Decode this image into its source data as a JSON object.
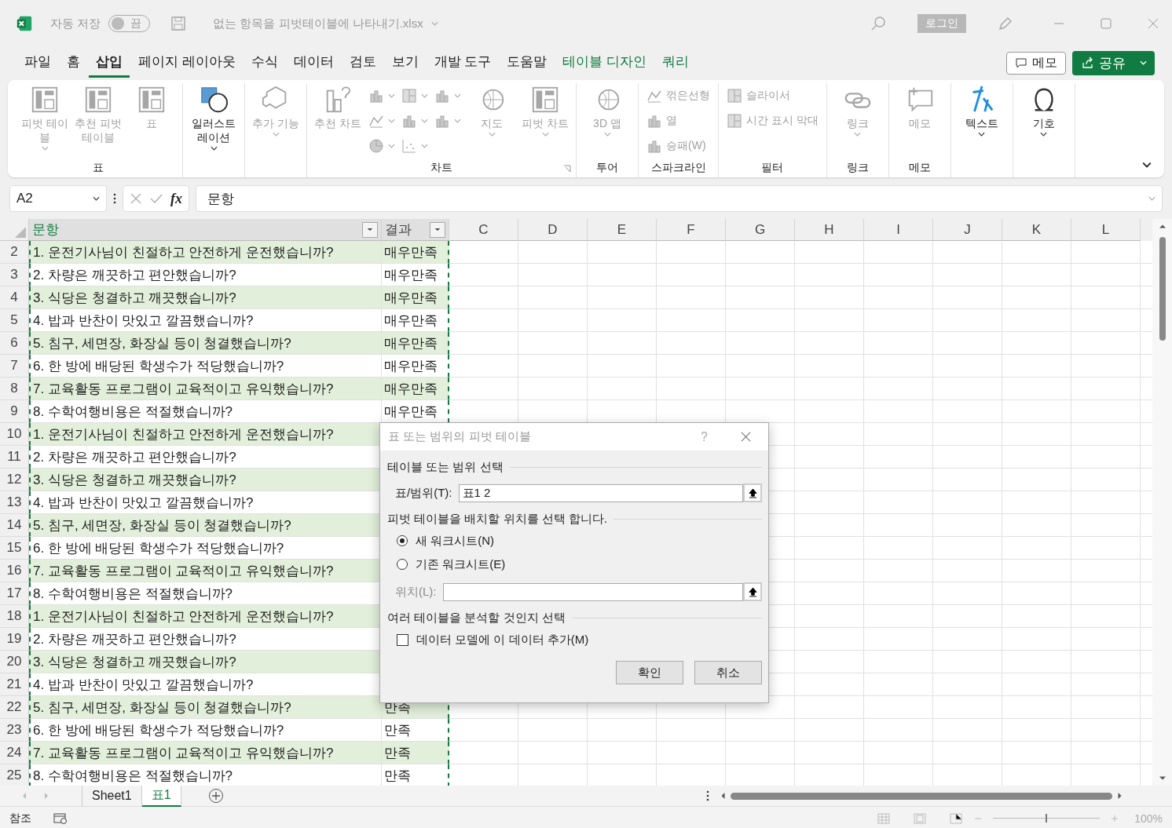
{
  "title_bar": {
    "autosave_label": "자동 저장",
    "autosave": {
      "label": "끔",
      "on": false
    },
    "filename": "없는 항목을 피벗테이블에 나타내기.xlsx",
    "login": "로그인"
  },
  "menu_tabs": [
    {
      "label": "파일",
      "selected": false,
      "kind": "normal"
    },
    {
      "label": "홈",
      "selected": false,
      "kind": "normal"
    },
    {
      "label": "삽입",
      "selected": true,
      "kind": "normal"
    },
    {
      "label": "페이지 레이아웃",
      "selected": false,
      "kind": "normal"
    },
    {
      "label": "수식",
      "selected": false,
      "kind": "normal"
    },
    {
      "label": "데이터",
      "selected": false,
      "kind": "normal"
    },
    {
      "label": "검토",
      "selected": false,
      "kind": "normal"
    },
    {
      "label": "보기",
      "selected": false,
      "kind": "normal"
    },
    {
      "label": "개발 도구",
      "selected": false,
      "kind": "normal"
    },
    {
      "label": "도움말",
      "selected": false,
      "kind": "normal"
    },
    {
      "label": "테이블 디자인",
      "selected": false,
      "kind": "contextual"
    },
    {
      "label": "쿼리",
      "selected": false,
      "kind": "contextual"
    }
  ],
  "comment_button": "메모",
  "share_button": "공유",
  "ribbon": [
    {
      "label": "표",
      "items": [
        {
          "kind": "large",
          "label": "피벗 테이블",
          "disabled": true,
          "dropdown": true
        },
        {
          "kind": "large",
          "label": "추천 피벗 테이블",
          "disabled": true,
          "dropdown": false
        },
        {
          "kind": "large",
          "label": "표",
          "disabled": true,
          "dropdown": false
        }
      ]
    },
    {
      "items": [
        {
          "kind": "large",
          "label": "일러스트레이션",
          "disabled": false,
          "dropdown": true
        }
      ]
    },
    {
      "items": [
        {
          "kind": "large",
          "label": "추가 기능",
          "disabled": true,
          "dropdown": true
        }
      ]
    },
    {
      "label": "차트",
      "launcher": true,
      "items": [
        {
          "kind": "large",
          "label": "추천 차트",
          "disabled": true,
          "dropdown": false
        },
        {
          "kind": "icon",
          "disabled": true,
          "dropdown": true
        },
        {
          "kind": "icon",
          "disabled": true,
          "dropdown": true
        },
        {
          "kind": "icon",
          "disabled": true,
          "dropdown": true
        },
        {
          "kind": "icon",
          "disabled": true,
          "dropdown": true
        },
        {
          "kind": "icon",
          "disabled": true,
          "dropdown": true
        },
        {
          "kind": "icon",
          "disabled": true,
          "dropdown": true
        },
        {
          "kind": "icon",
          "disabled": true,
          "dropdown": true
        },
        {
          "kind": "icon",
          "disabled": true,
          "dropdown": true
        },
        {
          "kind": "large",
          "label": "지도",
          "disabled": true,
          "dropdown": true
        },
        {
          "kind": "large",
          "label": "피벗 차트",
          "disabled": true,
          "dropdown": true
        }
      ]
    },
    {
      "label": "투어",
      "items": [
        {
          "kind": "large",
          "label": "3D 맵",
          "disabled": true,
          "dropdown": true
        }
      ]
    },
    {
      "label": "스파크라인",
      "items": [
        {
          "kind": "small",
          "label": "꺾은선형",
          "disabled": true
        },
        {
          "kind": "small",
          "label": "열",
          "disabled": true
        },
        {
          "kind": "small",
          "label": "승패(W)",
          "disabled": true
        }
      ]
    },
    {
      "label": "필터",
      "items": [
        {
          "kind": "small",
          "label": "슬라이서",
          "disabled": true
        },
        {
          "kind": "small",
          "label": "시간 표시 막대",
          "disabled": true
        }
      ]
    },
    {
      "label": "링크",
      "items": [
        {
          "kind": "large",
          "label": "링크",
          "disabled": true,
          "dropdown": true
        }
      ]
    },
    {
      "label": "메모",
      "items": [
        {
          "kind": "large",
          "label": "메모",
          "disabled": true,
          "dropdown": false
        }
      ]
    },
    {
      "items": [
        {
          "kind": "large",
          "label": "텍스트",
          "disabled": false,
          "dropdown": true
        }
      ]
    },
    {
      "items": [
        {
          "kind": "large",
          "label": "기호",
          "disabled": false,
          "dropdown": true
        }
      ]
    }
  ],
  "formula_bar": {
    "name_box": "A2",
    "function_label": "fx",
    "formula": "문항"
  },
  "columns": [
    {
      "label": "문항",
      "filter": true
    },
    {
      "label": "결과",
      "filter": true
    },
    {
      "label": "C",
      "filter": false
    },
    {
      "label": "D",
      "filter": false
    },
    {
      "label": "E",
      "filter": false
    },
    {
      "label": "F",
      "filter": false
    },
    {
      "label": "G",
      "filter": false
    },
    {
      "label": "H",
      "filter": false
    },
    {
      "label": "I",
      "filter": false
    },
    {
      "label": "J",
      "filter": false
    },
    {
      "label": "K",
      "filter": false
    },
    {
      "label": "L",
      "filter": false
    }
  ],
  "rows": [
    {
      "number": "2",
      "question": "1. 운전기사님이 친절하고 안전하게 운전했습니까?",
      "result": "매우만족"
    },
    {
      "number": "3",
      "question": "2. 차량은 깨끗하고 편안했습니까?",
      "result": "매우만족"
    },
    {
      "number": "4",
      "question": "3. 식당은 청결하고 깨끗했습니까?",
      "result": "매우만족"
    },
    {
      "number": "5",
      "question": "4. 밥과 반찬이 맛있고 깔끔했습니까?",
      "result": "매우만족"
    },
    {
      "number": "6",
      "question": "5. 침구, 세면장, 화장실 등이 청결했습니까?",
      "result": "매우만족"
    },
    {
      "number": "7",
      "question": "6. 한 방에 배당된 학생수가 적당했습니까?",
      "result": "매우만족"
    },
    {
      "number": "8",
      "question": "7. 교육활동 프로그램이 교육적이고 유익했습니까?",
      "result": "매우만족"
    },
    {
      "number": "9",
      "question": "8. 수학여행비용은 적절했습니까?",
      "result": "매우만족"
    },
    {
      "number": "10",
      "question": "1. 운전기사님이 친절하고 안전하게 운전했습니까?"
    },
    {
      "number": "11",
      "question": "2. 차량은 깨끗하고 편안했습니까?"
    },
    {
      "number": "12",
      "question": "3. 식당은 청결하고 깨끗했습니까?"
    },
    {
      "number": "13",
      "question": "4. 밥과 반찬이 맛있고 깔끔했습니까?"
    },
    {
      "number": "14",
      "question": "5. 침구, 세면장, 화장실 등이 청결했습니까?"
    },
    {
      "number": "15",
      "question": "6. 한 방에 배당된 학생수가 적당했습니까?"
    },
    {
      "number": "16",
      "question": "7. 교육활동 프로그램이 교육적이고 유익했습니까?"
    },
    {
      "number": "17",
      "question": "8. 수학여행비용은 적절했습니까?"
    },
    {
      "number": "18",
      "question": "1. 운전기사님이 친절하고 안전하게 운전했습니까?"
    },
    {
      "number": "19",
      "question": "2. 차량은 깨끗하고 편안했습니까?"
    },
    {
      "number": "20",
      "question": "3. 식당은 청결하고 깨끗했습니까?"
    },
    {
      "number": "21",
      "question": "4. 밥과 반찬이 맛있고 깔끔했습니까?"
    },
    {
      "number": "22",
      "question": "5. 침구, 세면장, 화장실 등이 청결했습니까?",
      "result": "만족"
    },
    {
      "number": "23",
      "question": "6. 한 방에 배당된 학생수가 적당했습니까?",
      "result": "만족"
    },
    {
      "number": "24",
      "question": "7. 교육활동 프로그램이 교육적이고 유익했습니까?",
      "result": "만족"
    },
    {
      "number": "25",
      "question": "8. 수학여행비용은 적절했습니까?",
      "result": "만족"
    }
  ],
  "sheet_tabs": [
    {
      "label": "Sheet1",
      "selected": false
    },
    {
      "label": "표1",
      "selected": true
    }
  ],
  "status_bar": {
    "mode": "참조",
    "zoom": {
      "level": 0.5,
      "reading": "100%"
    }
  },
  "dialog": {
    "title": "표 또는 범위의 피벗 테이블",
    "help": "?",
    "section_1": "테이블 또는 범위 선택",
    "range_label": "표/범위(T):",
    "range_value": "표1 2",
    "section_2": "피벗 테이블을 배치할 위치를 선택 합니다.",
    "placement": [
      {
        "label": "새 워크시트(N)",
        "selected": true
      },
      {
        "label": "기존 워크시트(E)",
        "selected": false
      }
    ],
    "location": {
      "label": "위치(L):",
      "disabled": true
    },
    "section_3": "여러 테이블을 분석할 것인지 선택",
    "data_model": {
      "label": "데이터 모델에 이 데이터 추가(M)",
      "checked": false
    },
    "ok_button": "확인",
    "cancel_button": "취소"
  }
}
